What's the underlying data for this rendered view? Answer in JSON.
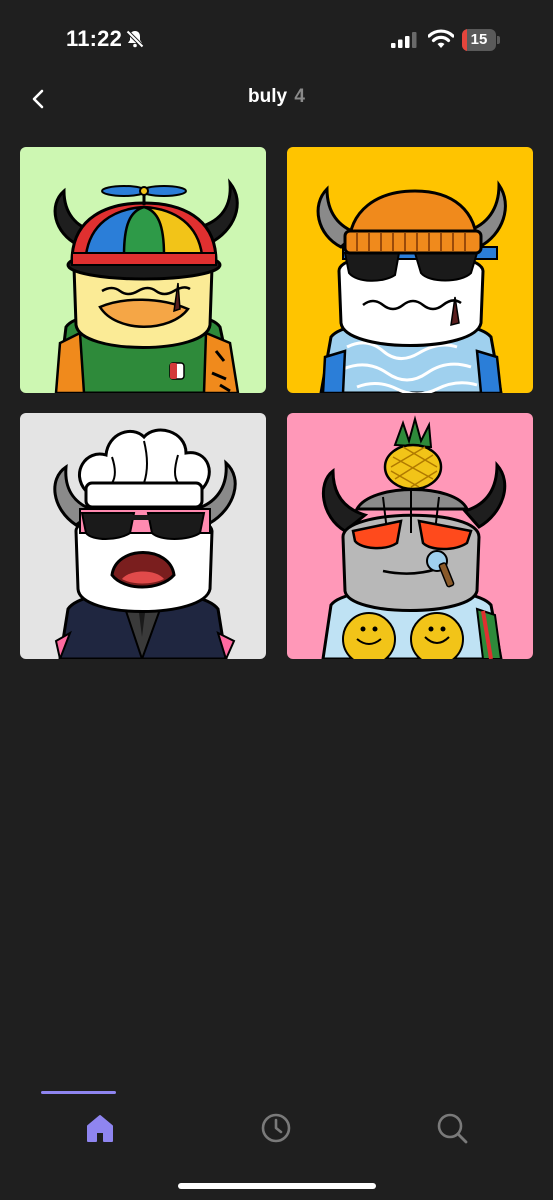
{
  "status_bar": {
    "time": "11:22",
    "battery_level": "15",
    "battery_percent": 15
  },
  "header": {
    "title": "buly",
    "count": "4"
  },
  "grid": {
    "items": [
      {
        "background": "#cdf7b2",
        "hat": "propeller-cap",
        "face": "#fbeb96"
      },
      {
        "background": "#ffc400",
        "hat": "orange-beanie",
        "face": "#ffffff"
      },
      {
        "background": "#e4e4e4",
        "hat": "chef-hat",
        "face": "#ffffff"
      },
      {
        "background": "#ff98b8",
        "hat": "pineapple",
        "face": "#b8b8b8"
      }
    ]
  },
  "tab_bar": {
    "tabs": [
      {
        "name": "home",
        "icon": "home-icon",
        "active": true
      },
      {
        "name": "history",
        "icon": "clock-icon",
        "active": false
      },
      {
        "name": "search",
        "icon": "search-icon",
        "active": false
      }
    ],
    "active_color": "#8f85f0",
    "inactive_color": "#7a7a7a"
  }
}
